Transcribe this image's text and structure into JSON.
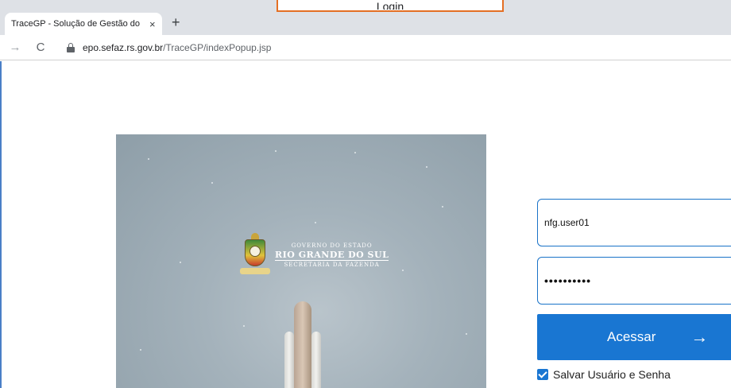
{
  "browser": {
    "tab_title": "TraceGP - Solução de Gestão do",
    "tab_close": "×",
    "new_tab": "+",
    "back": "→",
    "reload": "C",
    "url_domain": "epo.sefaz.rs.gov.br",
    "url_path": "/TraceGP/indexPopup.jsp",
    "overlay_text": "Login"
  },
  "brand": {
    "line1": "GOVERNO DO ESTADO",
    "line2": "RIO GRANDE DO SUL",
    "line3": "SECRETARIA DA FAZENDA"
  },
  "login": {
    "username": "nfg.user01",
    "password_mask": "••••••••••",
    "submit_label": "Acessar",
    "submit_arrow": "→",
    "remember_label": "Salvar Usuário e Senha"
  },
  "colors": {
    "accent": "#1976d2",
    "highlight_border": "#e46f24"
  }
}
